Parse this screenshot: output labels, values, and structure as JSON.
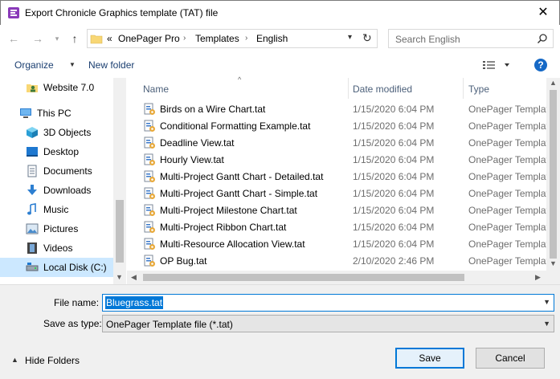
{
  "window": {
    "title": "Export Chronicle Graphics template (TAT) file"
  },
  "address": {
    "overflow": "«",
    "crumbs": [
      "OnePager Pro",
      "Templates",
      "English"
    ]
  },
  "search": {
    "placeholder": "Search English"
  },
  "toolbar": {
    "organize": "Organize",
    "new_folder": "New folder",
    "help": "?"
  },
  "nav": {
    "items": [
      {
        "label": "Website 7.0",
        "icon": "user-folder-icon"
      },
      {
        "label": "This PC",
        "icon": "computer-icon"
      },
      {
        "label": "3D Objects",
        "icon": "cube-icon"
      },
      {
        "label": "Desktop",
        "icon": "desktop-icon"
      },
      {
        "label": "Documents",
        "icon": "documents-icon"
      },
      {
        "label": "Downloads",
        "icon": "download-arrow-icon"
      },
      {
        "label": "Music",
        "icon": "music-note-icon"
      },
      {
        "label": "Pictures",
        "icon": "pictures-icon"
      },
      {
        "label": "Videos",
        "icon": "film-icon"
      },
      {
        "label": "Local Disk (C:)",
        "icon": "drive-icon"
      }
    ]
  },
  "list": {
    "columns": {
      "name": "Name",
      "date": "Date modified",
      "type": "Type"
    },
    "rows": [
      {
        "name": "Birds on a Wire Chart.tat",
        "date": "1/15/2020 6:04 PM",
        "type": "OnePager Template"
      },
      {
        "name": "Conditional Formatting Example.tat",
        "date": "1/15/2020 6:04 PM",
        "type": "OnePager Template"
      },
      {
        "name": "Deadline View.tat",
        "date": "1/15/2020 6:04 PM",
        "type": "OnePager Template"
      },
      {
        "name": "Hourly View.tat",
        "date": "1/15/2020 6:04 PM",
        "type": "OnePager Template"
      },
      {
        "name": "Multi-Project Gantt Chart - Detailed.tat",
        "date": "1/15/2020 6:04 PM",
        "type": "OnePager Template"
      },
      {
        "name": "Multi-Project Gantt Chart - Simple.tat",
        "date": "1/15/2020 6:04 PM",
        "type": "OnePager Template"
      },
      {
        "name": "Multi-Project Milestone Chart.tat",
        "date": "1/15/2020 6:04 PM",
        "type": "OnePager Template"
      },
      {
        "name": "Multi-Project Ribbon Chart.tat",
        "date": "1/15/2020 6:04 PM",
        "type": "OnePager Template"
      },
      {
        "name": "Multi-Resource Allocation View.tat",
        "date": "1/15/2020 6:04 PM",
        "type": "OnePager Template"
      },
      {
        "name": "OP Bug.tat",
        "date": "2/10/2020 2:46 PM",
        "type": "OnePager Template"
      }
    ]
  },
  "form": {
    "file_name_label": "File name:",
    "file_name_value": "Bluegrass.tat",
    "save_type_label": "Save as type:",
    "save_type_value": "OnePager Template file  (*.tat)"
  },
  "footer": {
    "hide_folders": "Hide Folders",
    "save": "Save",
    "cancel": "Cancel"
  }
}
